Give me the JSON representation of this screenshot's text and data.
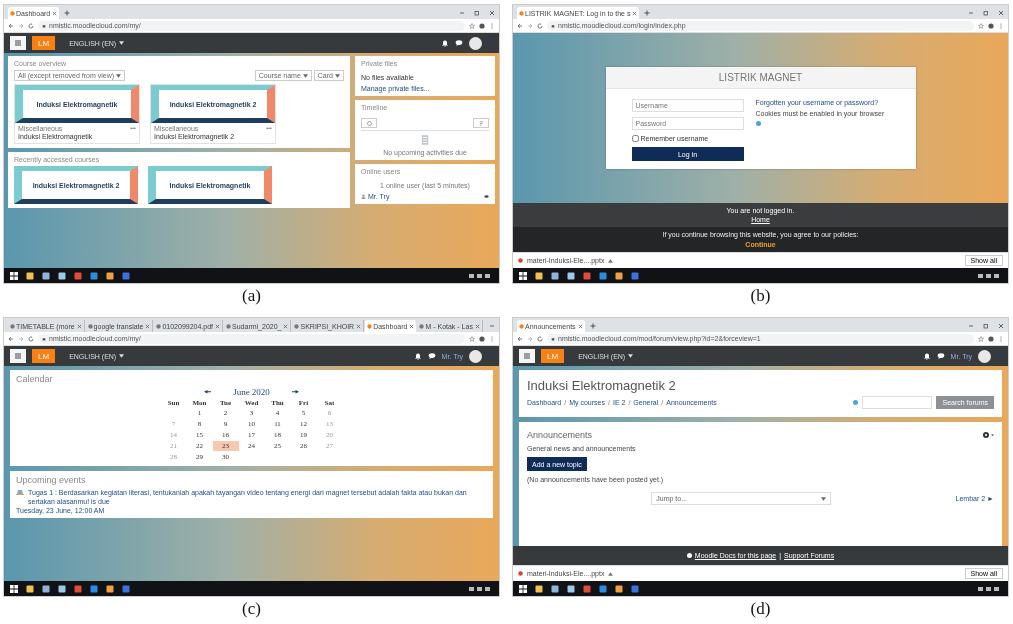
{
  "panels": [
    {
      "kind": "dashboard",
      "caption": "(a)",
      "browser": {
        "tabs": [
          {
            "label": "Dashboard",
            "selected": true
          }
        ],
        "url": "nmistic.moodlecloud.com/my/"
      },
      "navbar": {
        "logo": "LM",
        "language": "ENGLISH (EN)"
      },
      "course_overview": {
        "title": "Course overview",
        "filter": "All (except removed from view)",
        "sort": "Course name",
        "view": "Card",
        "courses": [
          {
            "banner": "Induksi Elektromagnetik",
            "category": "Miscellaneous",
            "name": "Induksi Elektromagnetik"
          },
          {
            "banner": "Induksi Elektromagnetik 2",
            "category": "Miscellaneous",
            "name": "Induksi Elektromagnetik 2"
          }
        ]
      },
      "recent": {
        "title": "Recently accessed courses",
        "courses": [
          {
            "banner": "Induksi Elektromagnetik 2"
          },
          {
            "banner": "Induksi Elektromagnetik"
          }
        ]
      },
      "blocks": [
        {
          "kind": "files",
          "title": "Private files",
          "text": "No files available",
          "link": "Manage private files..."
        },
        {
          "kind": "timeline",
          "title": "Timeline",
          "text": "No upcoming activities due"
        },
        {
          "kind": "users",
          "title": "Online users",
          "text": "1 online user (last 5 minutes)",
          "link": "Mr. Try"
        }
      ]
    },
    {
      "kind": "login",
      "caption": "(b)",
      "browser": {
        "tabs": [
          {
            "label": "LISTRIK MAGNET: Log in to the s",
            "selected": true
          }
        ],
        "url": "nmistic.moodlecloud.com/login/index.php",
        "download": {
          "file": "materi-Induksi-Ele....pptx",
          "button": "Show all"
        }
      },
      "login": {
        "site": "LISTRIK MAGNET",
        "username_placeholder": "Username",
        "password_placeholder": "Password",
        "remember": {
          "label": "Remember username",
          "checked": false
        },
        "button": "Log in",
        "forgot": "Forgotten your username or password?",
        "cookies": "Cookies must be enabled in your browser"
      },
      "footer": {
        "status": "You are not logged in.",
        "home": "Home",
        "notice": "If you continue browsing this website, you agree to our policies:",
        "continue": "Continue"
      }
    },
    {
      "kind": "calendar",
      "caption": "(c)",
      "browser": {
        "tabs": [
          {
            "label": "TIMETABLE (more",
            "selected": false
          },
          {
            "label": "google translate",
            "selected": false
          },
          {
            "label": "0102099204.pdf",
            "selected": false
          },
          {
            "label": "Sudarmi_2020_",
            "selected": false
          },
          {
            "label": "SKRIPSI_KHOIR",
            "selected": false
          },
          {
            "label": "Dashboard",
            "selected": true
          },
          {
            "label": "M - Kotak - Las",
            "selected": false
          }
        ],
        "url": "nmistic.moodlecloud.com/my/"
      },
      "navbar": {
        "logo": "LM",
        "language": "ENGLISH (EN)",
        "user": "Mr. Try"
      },
      "calendar": {
        "title": "Calendar",
        "month": "June 2020",
        "weekdays": [
          "Sun",
          "Mon",
          "Tue",
          "Wed",
          "Thu",
          "Fri",
          "Sat"
        ],
        "weeks": [
          [
            {
              "label": "1",
              "selected": false
            },
            {
              "label": "2",
              "selected": false
            },
            {
              "label": "3",
              "selected": false
            },
            {
              "label": "4",
              "selected": false
            },
            {
              "label": "5",
              "selected": false
            },
            {
              "label": "6",
              "selected": false
            }
          ],
          [
            {
              "label": "7",
              "selected": false
            },
            {
              "label": "8",
              "selected": false
            },
            {
              "label": "9",
              "selected": false
            },
            {
              "label": "10",
              "selected": false
            },
            {
              "label": "11",
              "selected": false
            },
            {
              "label": "12",
              "selected": false
            },
            {
              "label": "13",
              "selected": false
            }
          ],
          [
            {
              "label": "14",
              "selected": false
            },
            {
              "label": "15",
              "selected": false
            },
            {
              "label": "16",
              "selected": false
            },
            {
              "label": "17",
              "selected": false
            },
            {
              "label": "18",
              "selected": false
            },
            {
              "label": "19",
              "selected": false
            },
            {
              "label": "20",
              "selected": false
            }
          ],
          [
            {
              "label": "21",
              "selected": false
            },
            {
              "label": "22",
              "selected": false
            },
            {
              "label": "23",
              "selected": true
            },
            {
              "label": "24",
              "selected": false
            },
            {
              "label": "25",
              "selected": false
            },
            {
              "label": "26",
              "selected": false
            },
            {
              "label": "27",
              "selected": false
            }
          ],
          [
            {
              "label": "28",
              "selected": false
            },
            {
              "label": "29",
              "selected": false
            },
            {
              "label": "30",
              "selected": false
            }
          ]
        ]
      },
      "events": {
        "title": "Upcoming events",
        "items": [
          {
            "text": "Tugas 1 : Berdasarkan kegiatan literasi, tentukanlah apakah tayangan video tentang energi dari magnet tersebut adalah fakta atau bukan dan sertakan alasanmu! is due",
            "date": "Tuesday, 23 June, 12:00 AM"
          }
        ]
      }
    },
    {
      "kind": "forum",
      "caption": "(d)",
      "browser": {
        "tabs": [
          {
            "label": "Announcements",
            "selected": true
          }
        ],
        "url": "nmistic.moodlecloud.com/mod/forum/view.php?id=2&forceview=1",
        "download": {
          "file": "materi-Induksi-Ele....pptx",
          "button": "Show all"
        }
      },
      "navbar": {
        "logo": "LM",
        "language": "ENGLISH (EN)",
        "user": "Mr. Try"
      },
      "header": {
        "title": "Induksi Elektromagnetik 2",
        "breadcrumb": [
          "Dashboard",
          "My courses",
          "IE 2",
          "General",
          "Announcements"
        ],
        "separator": "/",
        "search_button": "Search forums"
      },
      "forum": {
        "title": "Announcements",
        "intro": "General news and announcements",
        "button": "Add a new topic",
        "empty": "(No announcements have been posted yet.)",
        "jump": "Jump to...",
        "next": "Lembar 2 ►"
      },
      "footer": {
        "links": [
          "Moodle Docs for this page",
          "Support Forums"
        ],
        "separator": "|"
      }
    }
  ]
}
